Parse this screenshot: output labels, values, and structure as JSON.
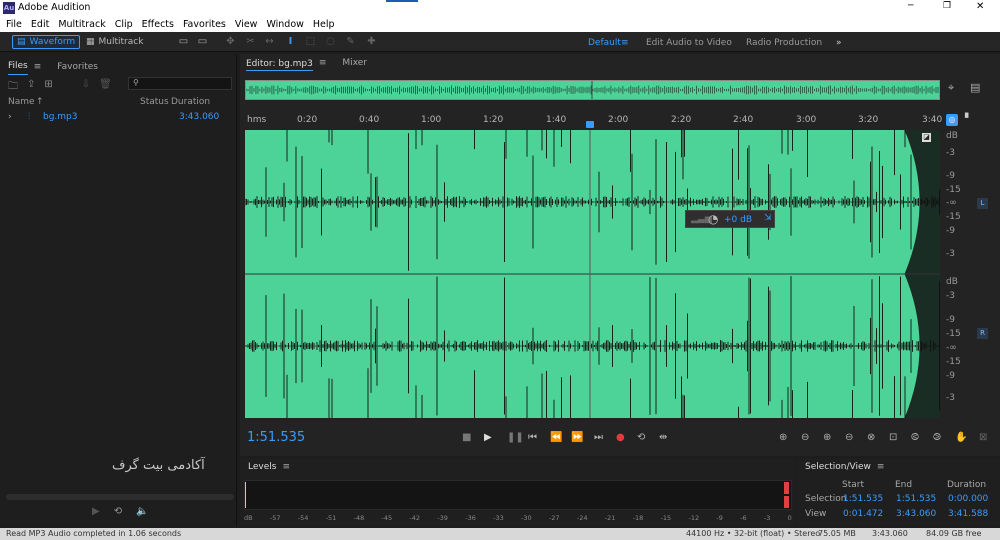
{
  "app": {
    "title": "Adobe Audition",
    "logo": "Au"
  },
  "window_controls": {
    "minimize": "─",
    "maximize": "❐",
    "close": "✕"
  },
  "menu": [
    "File",
    "Edit",
    "Multitrack",
    "Clip",
    "Effects",
    "Favorites",
    "View",
    "Window",
    "Help"
  ],
  "toolbar": {
    "waveform_label": "Waveform",
    "multitrack_label": "Multitrack"
  },
  "workspaces": {
    "default": "Default",
    "edit_av": "Edit Audio to Video",
    "radio": "Radio Production",
    "more": "»"
  },
  "files_panel": {
    "tab_files": "Files",
    "tab_favorites": "Favorites",
    "col_name": "Name",
    "col_status": "Status",
    "col_duration": "Duration",
    "file_name": "bg.mp3",
    "file_duration": "3:43.060",
    "watermark": "آکادمی بیت گرف"
  },
  "editor": {
    "tab_editor": "Editor: bg.mp3",
    "tab_mixer": "Mixer"
  },
  "ruler": {
    "unit": "hms",
    "ticks": [
      "0:20",
      "0:40",
      "1:00",
      "1:20",
      "1:40",
      "2:00",
      "2:20",
      "2:40",
      "3:00",
      "3:20",
      "3:40"
    ]
  },
  "db_scale": {
    "top": [
      "dB",
      "-3",
      "-9",
      "-15",
      "-∞",
      "-15",
      "-9",
      "-3"
    ],
    "bottom": [
      "dB",
      "-3",
      "-9",
      "-15",
      "-∞",
      "-15",
      "-9",
      "-3"
    ],
    "channel_left": "L",
    "channel_right": "R"
  },
  "hud": {
    "value": "+0 dB"
  },
  "transport": {
    "time": "1:51.535"
  },
  "levels": {
    "title": "Levels",
    "scale": [
      "dB",
      "-57",
      "-54",
      "-51",
      "-48",
      "-45",
      "-42",
      "-39",
      "-36",
      "-33",
      "-30",
      "-27",
      "-24",
      "-21",
      "-18",
      "-15",
      "-12",
      "-9",
      "-6",
      "-3",
      "0"
    ]
  },
  "selection": {
    "title": "Selection/View",
    "col_start": "Start",
    "col_end": "End",
    "col_duration": "Duration",
    "row_selection": "Selection",
    "row_view": "View",
    "sel_start": "1:51.535",
    "sel_end": "1:51.535",
    "sel_duration": "0:00.000",
    "view_start": "0:01.472",
    "view_end": "3:43.060",
    "view_duration": "3:41.588"
  },
  "status": {
    "message": "Read MP3 Audio completed in 1.06 seconds",
    "format": "44100 Hz • 32-bit (float) • Stereo",
    "size": "75.05 MB",
    "duration": "3:43.060",
    "free": "84.09 GB free"
  },
  "colors": {
    "waveform": "#4dd397",
    "accent": "#3a9bff",
    "background": "#1d1d1d"
  }
}
